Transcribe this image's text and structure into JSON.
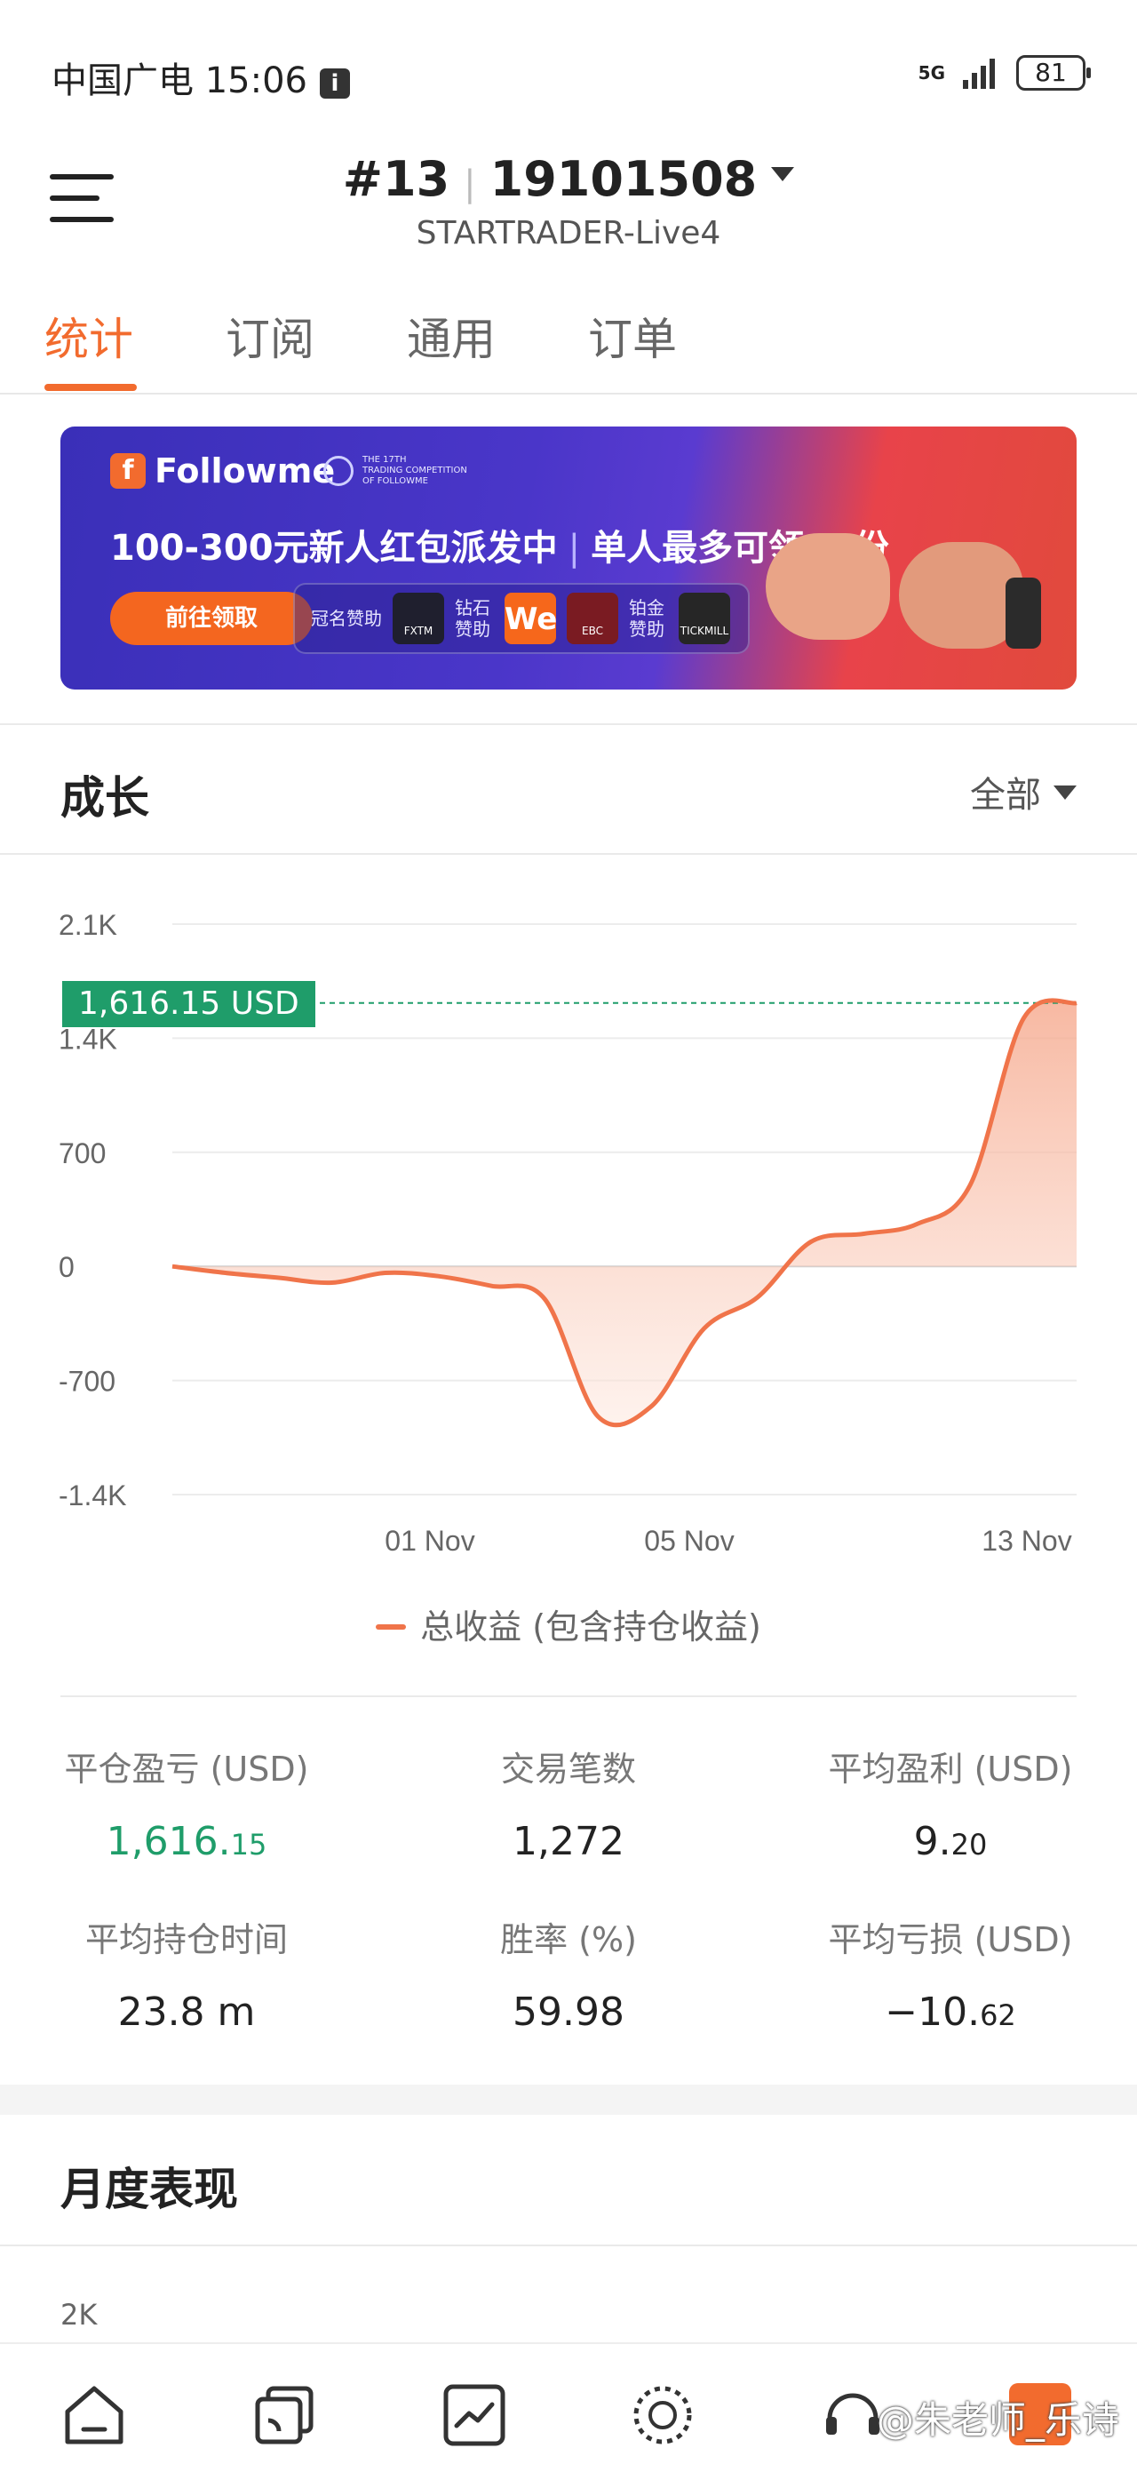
{
  "status": {
    "carrier_time": "中国广电 15:06",
    "info_icon": "i",
    "network": "5G",
    "battery": "81"
  },
  "header": {
    "account_rank": "#13",
    "account_id": "19101508",
    "server": "STARTRADER-Live4"
  },
  "tabs": [
    {
      "label": "统计",
      "active": true
    },
    {
      "label": "订阅",
      "active": false
    },
    {
      "label": "通用",
      "active": false
    },
    {
      "label": "订单",
      "active": false
    }
  ],
  "banner": {
    "brand": "Followme",
    "competition_line1": "THE 17TH",
    "competition_line2": "TRADING COMPETITION",
    "competition_line3": "OF FOLLOWME",
    "headline_left": "100-300元新人红包派发中",
    "headline_right": "单人最多可领 3 份",
    "cta": "前往领取",
    "sponsor_title": "冠名赞助",
    "sponsor_diamond": "钻石赞助",
    "sponsor_platinum": "铂金赞助",
    "sponsor_logos": [
      "FXTM",
      "We",
      "EBC",
      "TICKMILL"
    ]
  },
  "growth": {
    "title": "成长",
    "filter": "全部",
    "current_value_tag": "1,616.15 USD",
    "legend": "总收益 (包含持仓收益)"
  },
  "chart_data": {
    "type": "area",
    "y_ticks": [
      "2.1K",
      "1.4K",
      "700",
      "0",
      "-700",
      "-1.4K"
    ],
    "x_ticks": [
      "01 Nov",
      "05 Nov",
      "13 Nov"
    ],
    "ylim": [
      -1400,
      2100
    ],
    "reference_line": 1616.15,
    "series": [
      {
        "name": "总收益 (包含持仓收益)",
        "color": "#f0744a",
        "values": [
          0,
          -40,
          -70,
          -100,
          -40,
          -60,
          -120,
          -200,
          -920,
          -860,
          -380,
          -190,
          150,
          200,
          260,
          500,
          1520,
          1616.15
        ]
      }
    ]
  },
  "stats": [
    {
      "label": "平仓盈亏 (USD)",
      "value_main": "1,616.",
      "value_small": "15",
      "color": "green"
    },
    {
      "label": "交易笔数",
      "value_main": "1,272",
      "value_small": ""
    },
    {
      "label": "平均盈利 (USD)",
      "value_main": "9.",
      "value_small": "20"
    },
    {
      "label": "平均持仓时间",
      "value_main": "23.8 m",
      "value_small": ""
    },
    {
      "label": "胜率 (%)",
      "value_main": "59.98",
      "value_small": ""
    },
    {
      "label": "平均亏损 (USD)",
      "value_main": "−10.",
      "value_small": "62"
    }
  ],
  "monthly": {
    "title": "月度表现",
    "first_tick": "2K"
  },
  "watermark": "@朱老师_乐诗",
  "nav": [
    "home-icon",
    "copy-icon",
    "chart-icon",
    "community-icon",
    "support-icon"
  ]
}
